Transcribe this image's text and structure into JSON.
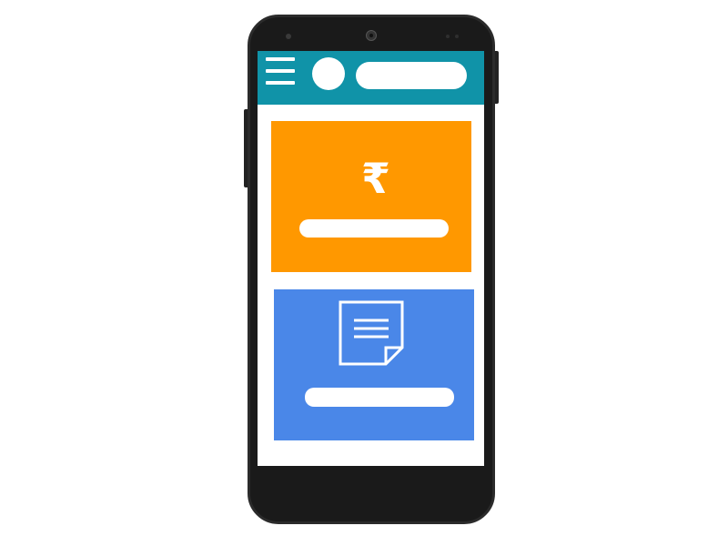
{
  "device": {
    "frame_color": "#1a1a1a"
  },
  "appbar": {
    "color": "#1093a8",
    "menu_icon": "hamburger-menu-icon",
    "avatar_icon": "profile-avatar",
    "search_icon": "search-pill"
  },
  "cards": [
    {
      "id": "payments",
      "color": "#ff9800",
      "icon": "rupee-icon",
      "symbol": "₹",
      "label": ""
    },
    {
      "id": "documents",
      "color": "#4a87e8",
      "icon": "document-icon",
      "label": ""
    }
  ]
}
